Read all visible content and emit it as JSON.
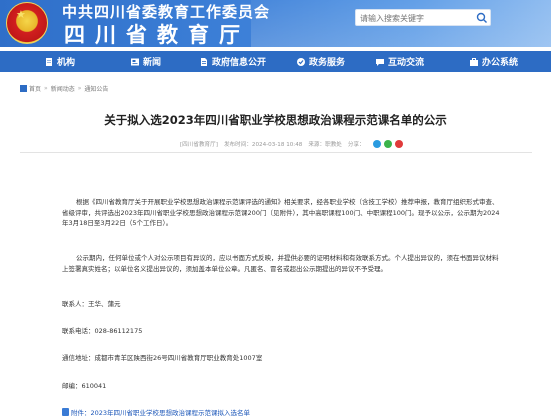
{
  "header": {
    "subtitle": "中共四川省委教育工作委员会",
    "title": "四川省教育厅",
    "search_placeholder": "请输入搜索关键字"
  },
  "nav": {
    "items": [
      {
        "label": "机构",
        "icon": "building-icon"
      },
      {
        "label": "新闻",
        "icon": "news-icon"
      },
      {
        "label": "政府信息公开",
        "icon": "document-icon"
      },
      {
        "label": "政务服务",
        "icon": "service-icon"
      },
      {
        "label": "互动交流",
        "icon": "chat-icon"
      },
      {
        "label": "办公系统",
        "icon": "office-icon"
      }
    ]
  },
  "breadcrumb": {
    "home": "首页",
    "section": "新闻动态",
    "current": "通知公告"
  },
  "article": {
    "title": "关于拟入选2023年四川省职业学校思想政治课程示范课名单的公示",
    "source": "[四川省教育厅]",
    "date": "发布时间：2024-03-18 10:48",
    "origin": "来源：职教处",
    "share_label": "分享：",
    "para1": "根据《四川省教育厅关于开展职业学校思想政治课程示范课评选的通知》相关要求，经各职业学校（含技工学校）推荐申报，教育厅组织形式审查、省级评审，共评选出2023年四川省职业学校思想政治课程示范课200门（见附件），其中高职课程100门、中职课程100门。现予以公示，公示期为2024年3月18日至3月22日（5个工作日）。",
    "para2": "公示期内，任何单位或个人对公示项目有异议的，应以书面方式反映，并提供必要的证明材料和有效联系方式。个人提出异议的，须在书面异议材料上签署真实姓名；以单位名义提出异议的，须加盖本单位公章。凡匿名、冒名或超出公示期提出的异议不予受理。",
    "contact": "联系人：王华、蒲元",
    "phone": "联系电话：028-86112175",
    "address": "通信地址：成都市青羊区陕西街26号四川省教育厅职业教育处1007室",
    "postal": "邮编：610041",
    "attachment": "附件：2023年四川省职业学校思想政治课程示范课拟入选名单"
  },
  "colors": {
    "brand_blue": "#2d6cc4",
    "wechat_green": "#3bb34a",
    "weibo_red": "#e03a3a",
    "qq_blue": "#2a9be0"
  }
}
